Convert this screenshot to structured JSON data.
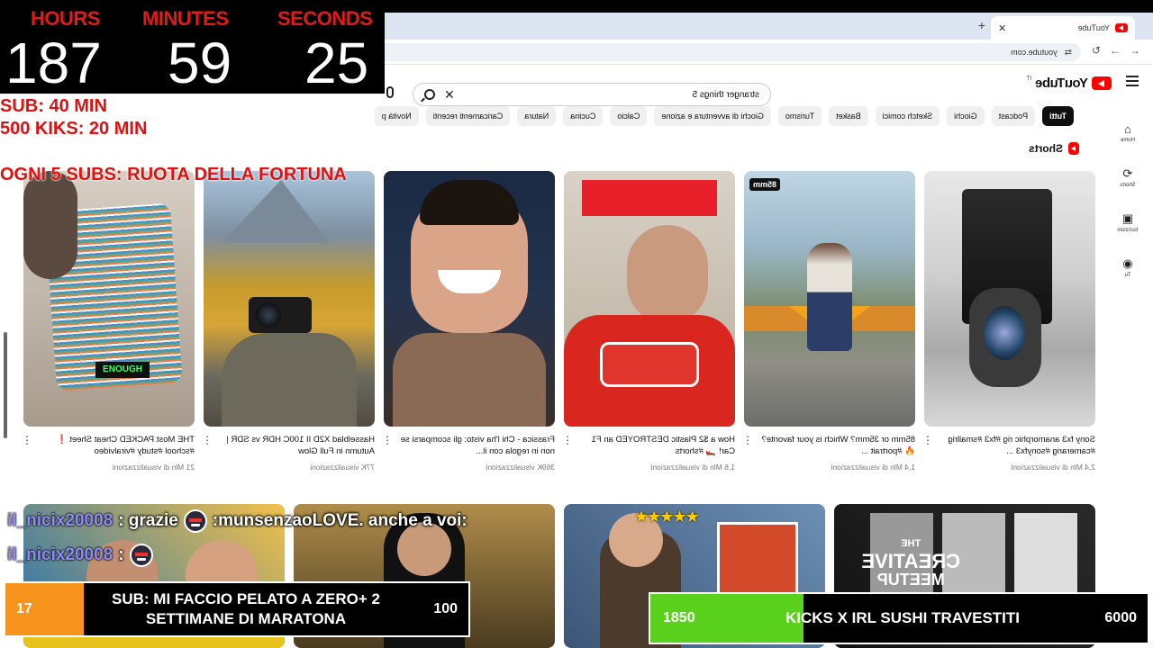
{
  "browser": {
    "tab_title": "YouTube",
    "url": "youtube.com"
  },
  "youtube": {
    "logo_text": "YouTube",
    "logo_cc": "IT",
    "search_query": "stranger things 5",
    "chips": [
      "Tutti",
      "Podcast",
      "Giochi",
      "Sketch comici",
      "Basket",
      "Turismo",
      "Giochi di avventura e azione",
      "Calcio",
      "Cucina",
      "Natura",
      "Caricamenti recenti",
      "Novità p"
    ],
    "sidebar": [
      {
        "label": "Home",
        "icon": "home-icon"
      },
      {
        "label": "Shorts",
        "icon": "shorts-icon"
      },
      {
        "label": "Iscrizioni",
        "icon": "subscriptions-icon"
      },
      {
        "label": "Tu",
        "icon": "you-icon"
      }
    ],
    "shorts_title": "Shorts",
    "shorts": [
      {
        "title": "Sony fx3 anamorphic rig #fx3 #smallrig #camerarig #sonyfx3 ...",
        "views": "2,4 Mln di visualizzazioni",
        "badge": ""
      },
      {
        "title": "85mm or 35mm? Which is your favorite? 🔥 #portrait ...",
        "views": "1,4 Mln di visualizzazioni",
        "badge": "85mm"
      },
      {
        "title": "How a $2 Plastic DESTROYED an F1 Car! 🏎️ #shorts",
        "views": "1,6 Mln di visualizzazioni",
        "badge": ""
      },
      {
        "title": "Frassica - Chi l'ha visto: gli scomparsi se non in regola con il...",
        "views": "369K visualizzazioni",
        "badge": ""
      },
      {
        "title": "Hasselblad X2D II 100C HDR vs SDR | Autumn in Full Glow",
        "views": "77K visualizzazioni",
        "badge": ""
      },
      {
        "title": "THE Most PACKED Cheat Sheet ❗ #school #study #viralvideo",
        "views": "21 Mln di visualizzazioni",
        "badge": ""
      }
    ],
    "video_text": {
      "creative_l1": "THE",
      "creative_l2": "CREATIVE",
      "creative_l3": "MEETUP",
      "stars": "★★★★★"
    }
  },
  "overlay": {
    "timer": {
      "hours_label": "HOURS",
      "minutes_label": "MINUTES",
      "seconds_label": "SECONDS",
      "hours": "187",
      "minutes": "59",
      "seconds": "25"
    },
    "rules": [
      "SUB: 40 MIN",
      "500 KIKS: 20 MIN",
      "OGNI 5 SUBS: RUOTA DELLA FORTUNA"
    ],
    "chat": [
      {
        "user": "il_nicix20008",
        "message": ": grazie",
        "message2": ":munsenzaoLOVE. anche a voi:"
      },
      {
        "user": "il_nicix20008",
        "message": ":"
      }
    ],
    "sub_goal": {
      "current": "17",
      "target": "100",
      "text": "SUB: MI FACCIO PELATO A ZERO+ 2 SETTIMANE DI MARATONA",
      "progress": 0.17,
      "color": "#f7941d"
    },
    "kicks_goal": {
      "current": "1850",
      "target": "6000",
      "text": "KICKS X IRL SUSHI TRAVESTITI",
      "progress": 0.3083,
      "color": "#5ad11c"
    }
  }
}
